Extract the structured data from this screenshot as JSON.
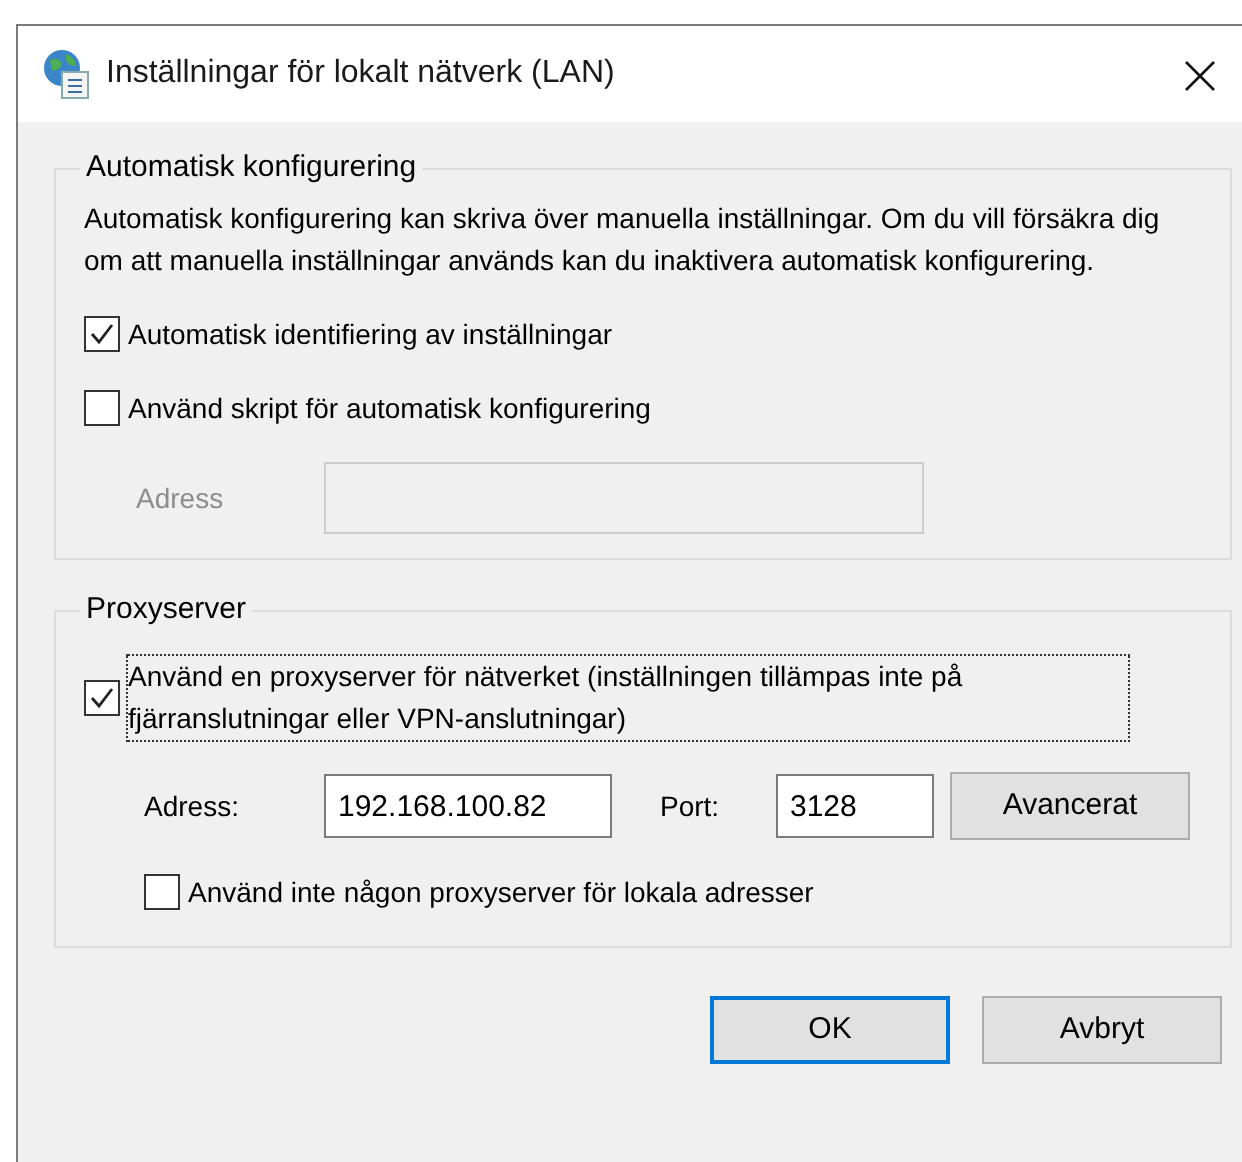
{
  "window": {
    "title": "Inställningar för lokalt nätverk (LAN)"
  },
  "auto_config": {
    "legend": "Automatisk konfigurering",
    "description": "Automatisk konfigurering kan skriva över manuella inställningar. Om du vill försäkra dig om att manuella inställningar används kan du inaktivera automatisk konfigurering.",
    "options": [
      {
        "label": "Automatisk identifiering av inställningar",
        "checked": true
      },
      {
        "label": "Använd skript för automatisk konfigurering",
        "checked": false
      }
    ],
    "script_address": {
      "label": "Adress",
      "disabled": true
    }
  },
  "proxy": {
    "legend": "Proxyserver",
    "use_proxy": {
      "label": "Använd en proxyserver för nätverket (inställningen tillämpas inte på fjärranslutningar eller VPN-anslutningar)",
      "checked": true,
      "focused": true
    },
    "address": {
      "label": "Adress:",
      "value": "192.168.100.82"
    },
    "port": {
      "label": "Port:",
      "value": "3128"
    },
    "advanced_button": "Avancerat",
    "bypass_local": {
      "label": "Använd inte någon proxyserver för lokala adresser",
      "checked": false
    }
  },
  "buttons": [
    {
      "label": "OK",
      "default": true
    },
    {
      "label": "Avbryt",
      "default": false
    }
  ]
}
